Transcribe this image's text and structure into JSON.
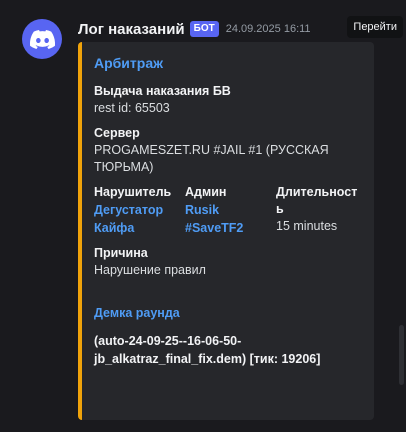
{
  "message": {
    "username": "Лог наказаний",
    "bot_tag": "БОТ",
    "timestamp": "24.09.2025 16:11",
    "goto_label": "Перейти"
  },
  "embed": {
    "accent_color": "#f0a30b",
    "title": "Арбитраж",
    "heading": "Выдача наказания БВ",
    "rest_id": "rest id: 65503",
    "server_label": "Сервер",
    "server_value": "PROGAMESZET.RU #JAIL #1 (РУССКАЯ ТЮРЬМА)",
    "fields": {
      "violator_label": "Нарушитель",
      "violator_value": "Дегустатор Кайфа",
      "admin_label": "Админ",
      "admin_value": "Rusik #SaveTF2",
      "duration_label": "Длительность",
      "duration_value": "15 minutes"
    },
    "reason_label": "Причина",
    "reason_value": "Нарушение правил",
    "demo_title": "Демка раунда",
    "demo_text": "(auto-24-09-25--16-06-50-jb_alkatraz_final_fix.dem) [тик: 19206]"
  },
  "colors": {
    "brand": "#5865f2",
    "link": "#4f9cf5"
  },
  "icons": {
    "avatar": "discord-logo-icon"
  }
}
